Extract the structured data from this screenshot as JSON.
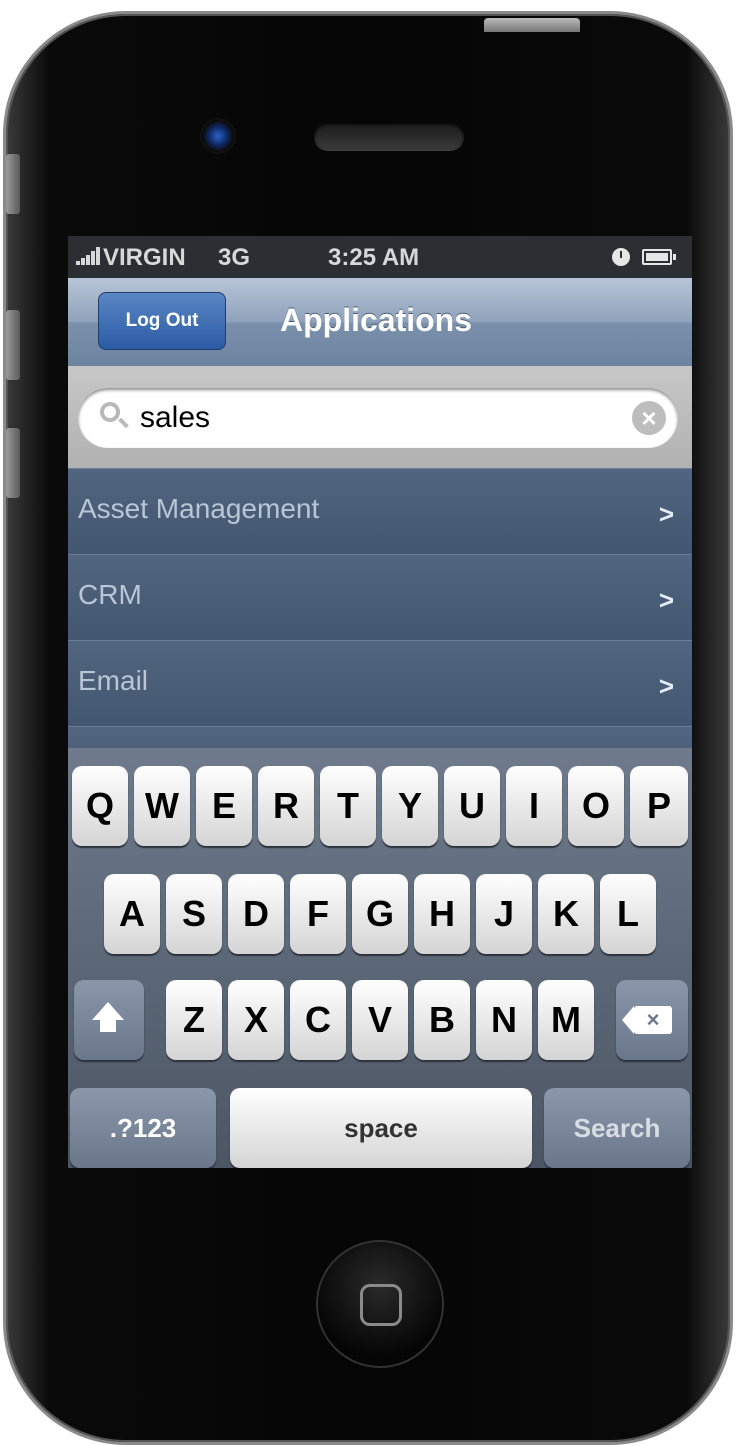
{
  "status_bar": {
    "carrier": "VIRGIN",
    "network": "3G",
    "time": "3:25 AM"
  },
  "nav": {
    "back_label": "Log Out",
    "title": "Applications"
  },
  "search": {
    "value": "sales"
  },
  "list": [
    {
      "label": "Asset Management",
      "chevron": ">"
    },
    {
      "label": "CRM",
      "chevron": ">"
    },
    {
      "label": "Email",
      "chevron": ">"
    }
  ],
  "keyboard": {
    "row1": [
      "Q",
      "W",
      "E",
      "R",
      "T",
      "Y",
      "U",
      "I",
      "O",
      "P"
    ],
    "row2": [
      "A",
      "S",
      "D",
      "F",
      "G",
      "H",
      "J",
      "K",
      "L"
    ],
    "row3": [
      "Z",
      "X",
      "C",
      "V",
      "B",
      "N",
      "M"
    ],
    "numbers_label": ".?123",
    "space_label": "space",
    "search_label": "Search"
  }
}
